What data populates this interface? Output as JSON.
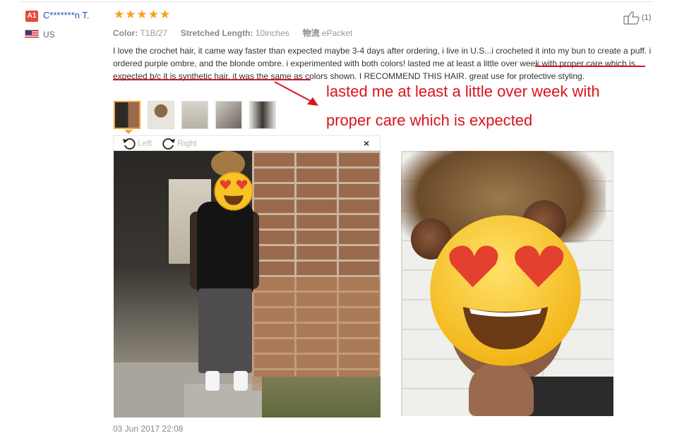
{
  "reviewer": {
    "badge": "A1",
    "name": "C*******n T.",
    "country": "US",
    "flag": "us-flag"
  },
  "rating": {
    "stars": 5,
    "max": 5,
    "star_char": "★",
    "color": "#f7a11a"
  },
  "helpful": {
    "count_label": "(1)",
    "icon": "thumbs-up-icon"
  },
  "attributes": {
    "color_label": "Color:",
    "color_value": "T1B/27",
    "length_label": "Stretched Length:",
    "length_value": "10inches",
    "shipping_label": "物流",
    "shipping_value": "ePacket"
  },
  "review_text": {
    "part1": "I love the crochet hair, it came way faster than expected maybe 3-4 days after ordering, i live in U.S...i crocheted it into my bun to create a puff. i ordered purple ombre, and the blonde ombre. i experimented with both colors! ",
    "highlight": "lasted me at least a little over week with proper care which is expected",
    "part2": " b/c it is synthetic hair. it was the same as colors shown. I RECOMMEND THIS HAIR. great use for protective styling."
  },
  "annotation": {
    "line1": "lasted me at least a little over week with",
    "line2": "proper care which is expected",
    "color": "#d9141b"
  },
  "viewer": {
    "rotate_left": "Left",
    "rotate_right": "Right",
    "close": "×"
  },
  "thumbnails": [
    {
      "name": "thumb-1",
      "active": true
    },
    {
      "name": "thumb-2",
      "active": false
    },
    {
      "name": "thumb-3",
      "active": false
    },
    {
      "name": "thumb-4",
      "active": false
    },
    {
      "name": "thumb-5",
      "active": false
    }
  ],
  "date": "03 Jun 2017 22:08"
}
